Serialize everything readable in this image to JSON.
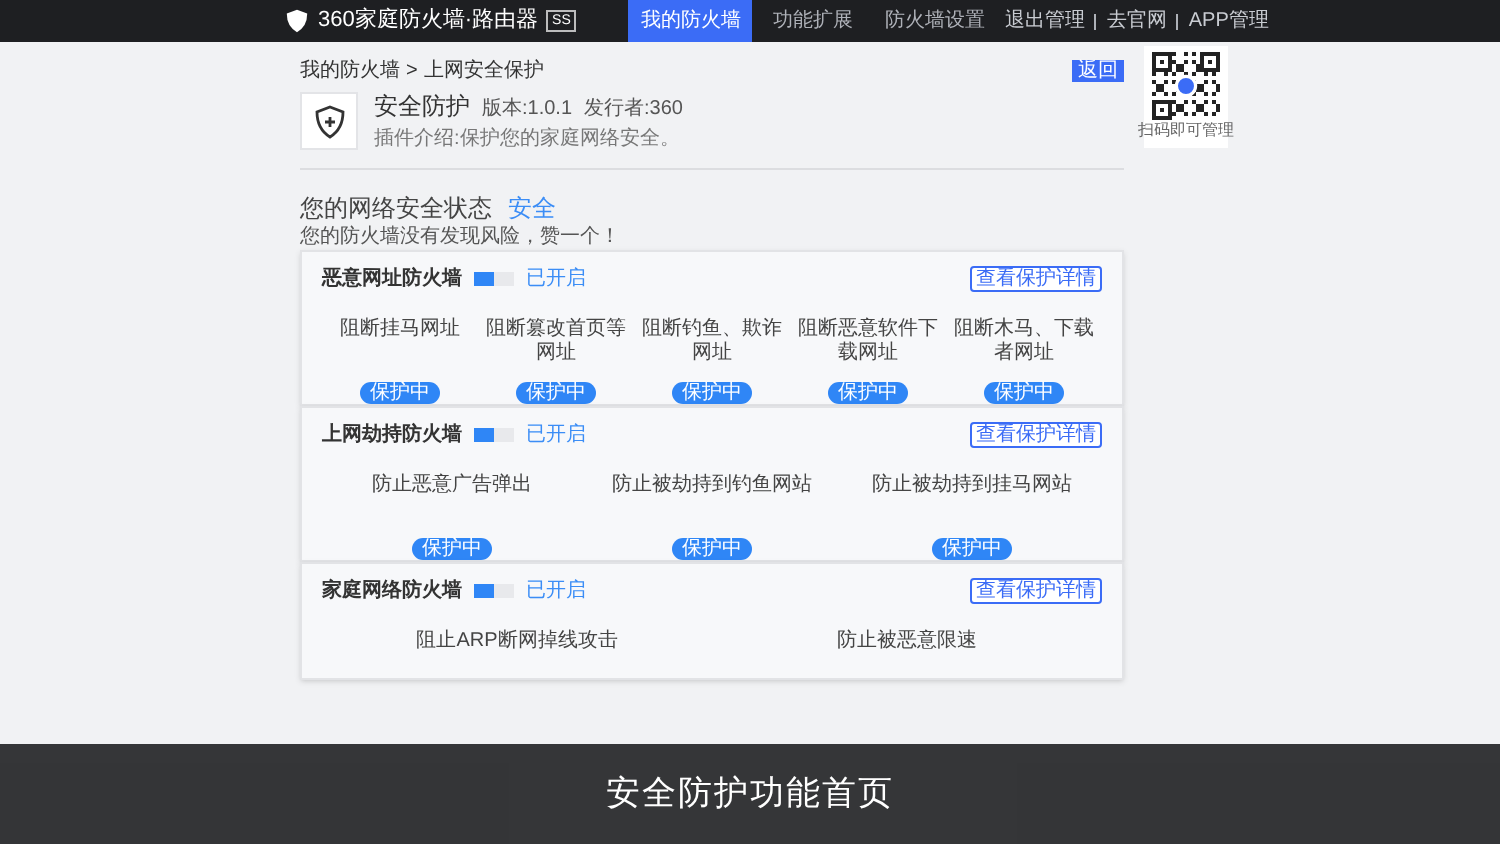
{
  "top_bar": {
    "logo_text": "360家庭防火墙·路由器",
    "model_badge": "SS",
    "nav_tabs": [
      {
        "label": "我的防火墙",
        "selected": true
      },
      {
        "label": "功能扩展",
        "selected": false
      },
      {
        "label": "防火墙设置",
        "selected": false
      }
    ],
    "links": [
      "退出管理",
      "去官网",
      "APP管理"
    ]
  },
  "qr_popup": {
    "caption": "扫码即可管理"
  },
  "breadcrumb": {
    "items": [
      "我的防火墙",
      "上网安全保护"
    ],
    "separator": ">"
  },
  "back_button": "返回",
  "plugin": {
    "name": "安全防护",
    "version": "版本:1.0.1",
    "publisher": "发行者:360",
    "description": "插件介绍:保护您的家庭网络安全。"
  },
  "status": {
    "label": "您的网络安全状态",
    "value": "安全",
    "note": "您的防火墙没有发现风险，赞一个！"
  },
  "firewalls": [
    {
      "title": "恶意网址防火墙",
      "switch_on": true,
      "switch_status": "已开启",
      "details_button": "查看保护详情",
      "items": [
        {
          "label": "阻断挂马网址",
          "badge": "保护中"
        },
        {
          "label": "阻断篡改首页等网址",
          "badge": "保护中"
        },
        {
          "label": "阻断钓鱼、欺诈网址",
          "badge": "保护中"
        },
        {
          "label": "阻断恶意软件下载网址",
          "badge": "保护中"
        },
        {
          "label": "阻断木马、下载者网址",
          "badge": "保护中"
        }
      ]
    },
    {
      "title": "上网劫持防火墙",
      "switch_on": true,
      "switch_status": "已开启",
      "details_button": "查看保护详情",
      "items": [
        {
          "label": "防止恶意广告弹出",
          "badge": "保护中"
        },
        {
          "label": "防止被劫持到钓鱼网站",
          "badge": "保护中"
        },
        {
          "label": "防止被劫持到挂马网站",
          "badge": "保护中"
        }
      ]
    },
    {
      "title": "家庭网络防火墙",
      "switch_on": true,
      "switch_status": "已开启",
      "details_button": "查看保护详情",
      "items": [
        {
          "label": "阻止ARP断网掉线攻击"
        },
        {
          "label": "防止被恶意限速"
        }
      ]
    }
  ],
  "caption": "安全防护功能首页"
}
